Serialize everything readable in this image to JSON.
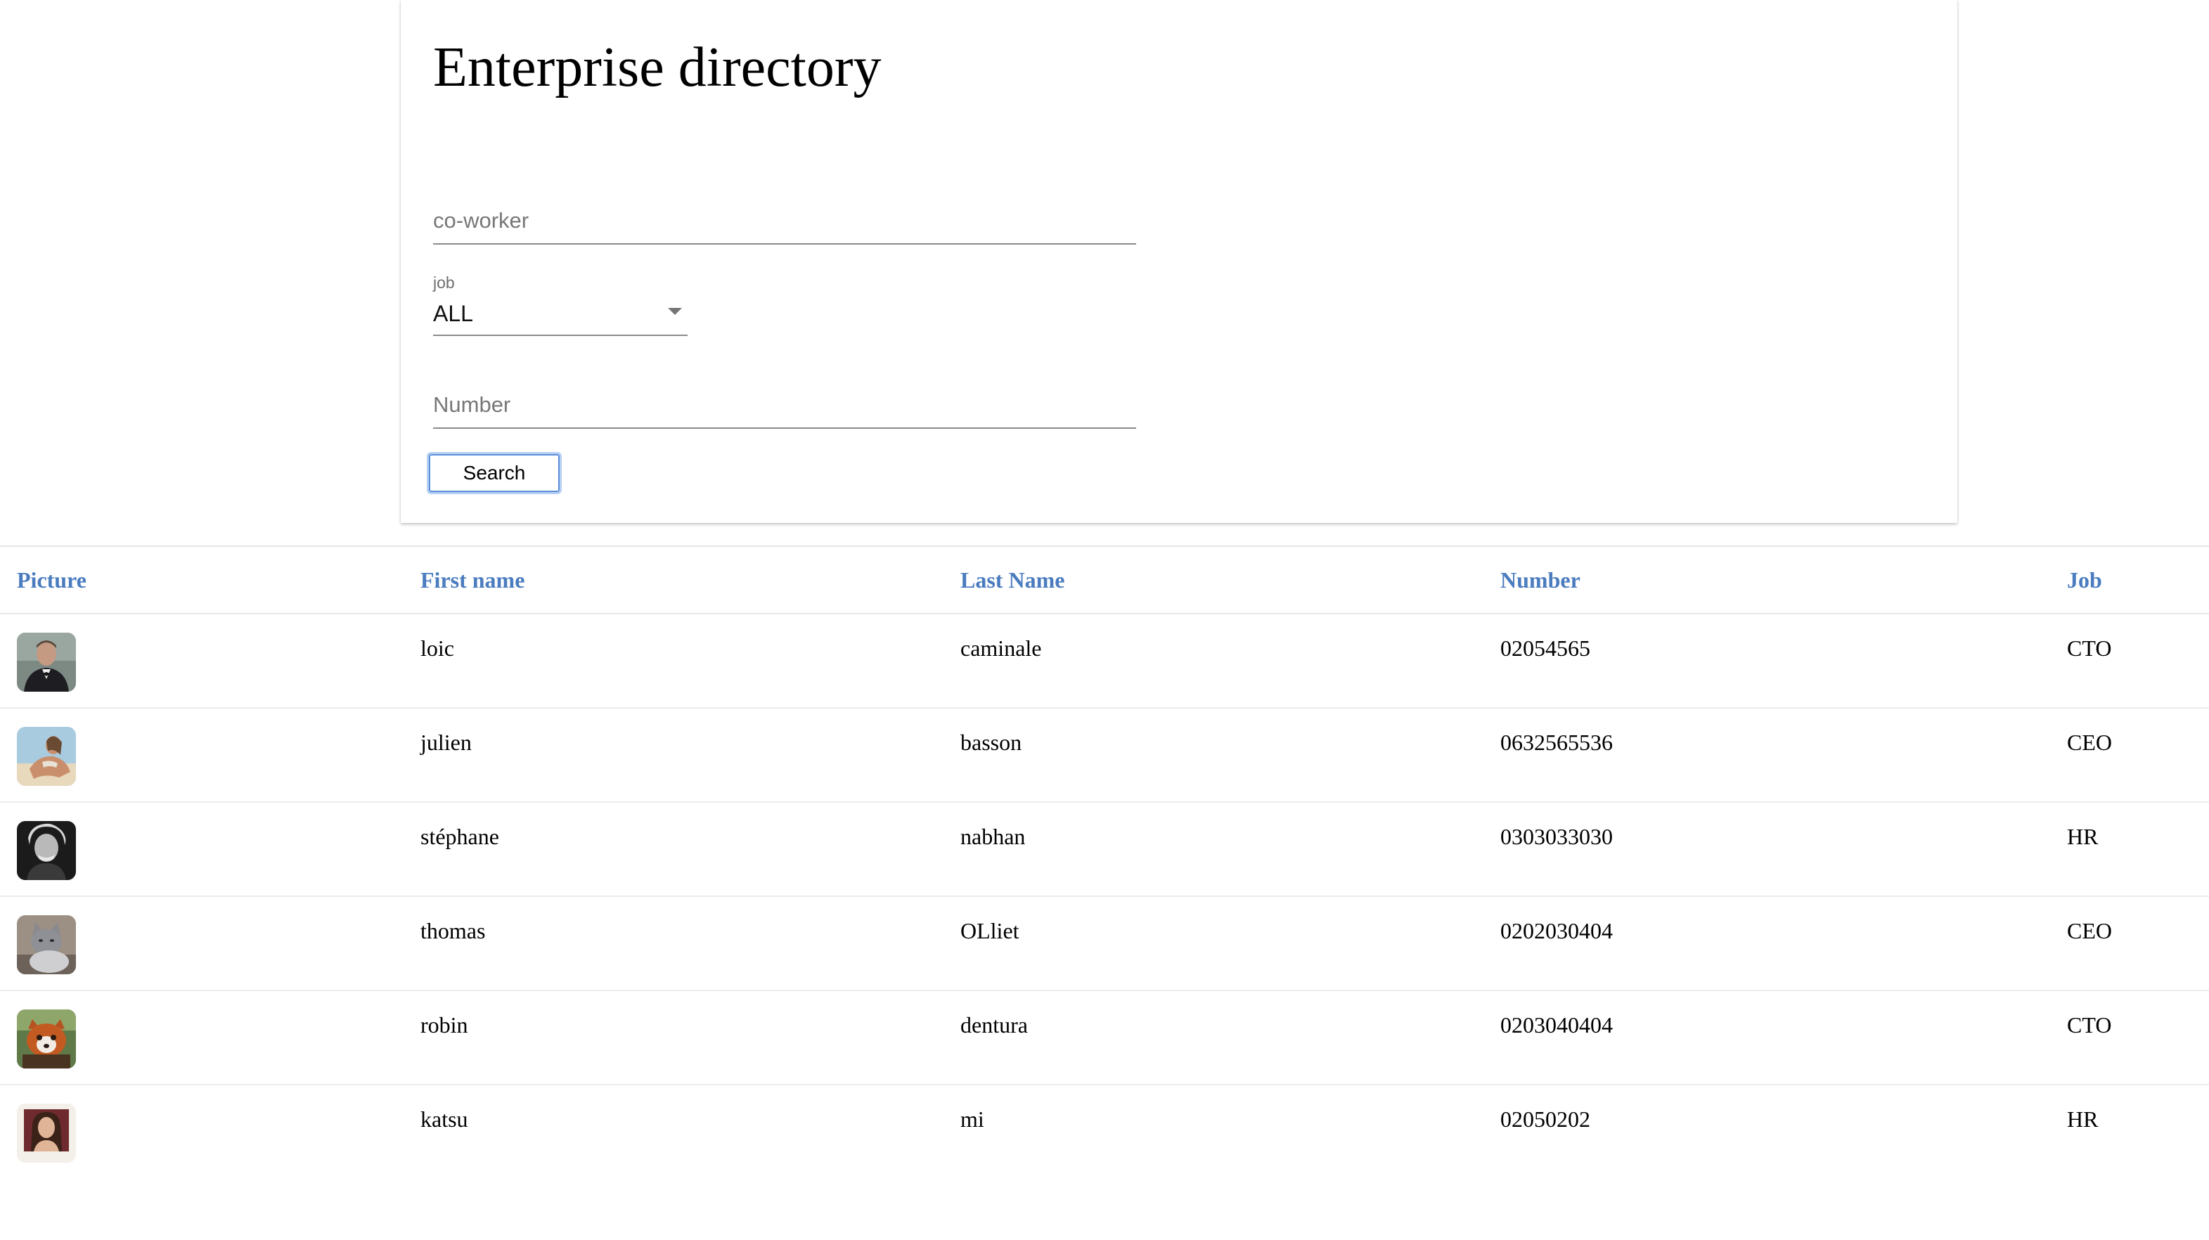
{
  "page": {
    "title": "Enterprise directory"
  },
  "form": {
    "coworker_placeholder": "co-worker",
    "job_label": "job",
    "job_value": "ALL",
    "number_placeholder": "Number",
    "search_label": "Search"
  },
  "table": {
    "headers": [
      "Picture",
      "First name",
      "Last Name",
      "Number",
      "Job"
    ],
    "rows": [
      {
        "first_name": "loic",
        "last_name": "caminale",
        "number": "02054565",
        "job": "CTO",
        "picture": "man-in-tuxedo-photo"
      },
      {
        "first_name": "julien",
        "last_name": "basson",
        "number": "0632565536",
        "job": "CEO",
        "picture": "woman-at-beach-photo"
      },
      {
        "first_name": "stéphane",
        "last_name": "nabhan",
        "number": "0303033030",
        "job": "HR",
        "picture": "black-and-white-portrait-photo"
      },
      {
        "first_name": "thomas",
        "last_name": "OLliet",
        "number": "0202030404",
        "job": "CEO",
        "picture": "cat-photo"
      },
      {
        "first_name": "robin",
        "last_name": "dentura",
        "number": "0203040404",
        "job": "CTO",
        "picture": "red-panda-photo"
      },
      {
        "first_name": "katsu",
        "last_name": "mi",
        "number": "02050202",
        "job": "HR",
        "picture": "woman-portrait-photo"
      }
    ]
  },
  "colors": {
    "header_text": "#4a7cbf",
    "button_focus": "#5b8fd8"
  }
}
